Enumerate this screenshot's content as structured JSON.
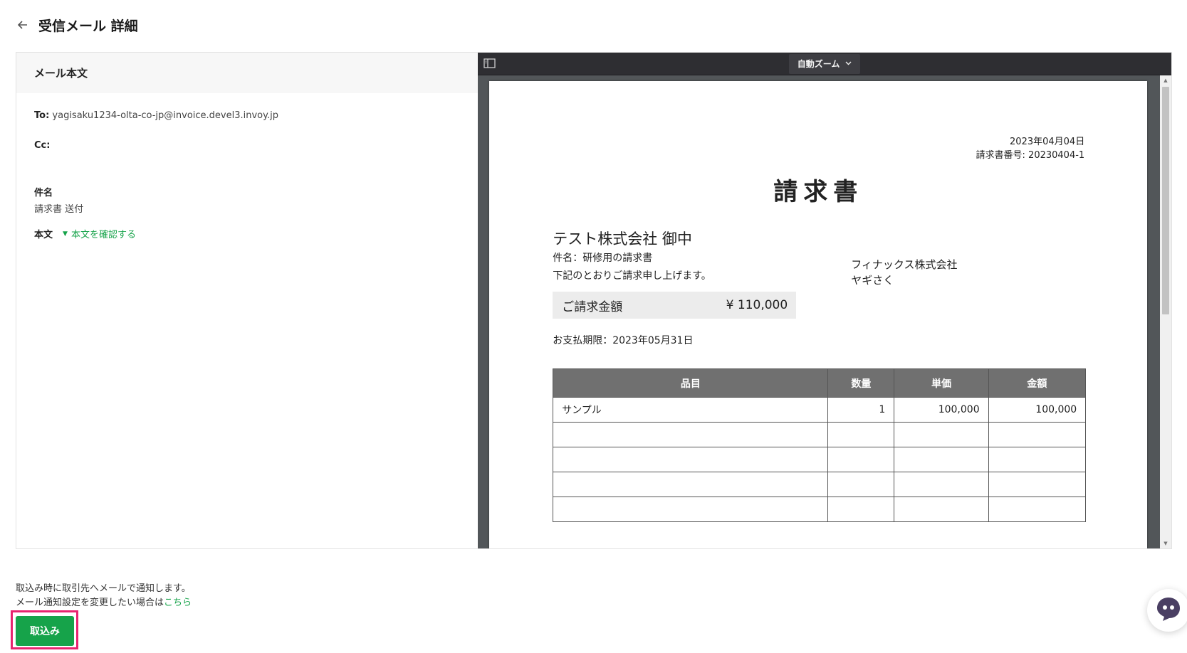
{
  "header": {
    "title": "受信メール 詳細",
    "back_icon": "arrow-left-icon"
  },
  "mail": {
    "section_title": "メール本文",
    "to_label": "To:",
    "to_value": "yagisaku1234-olta-co-jp@invoice.devel3.invoy.jp",
    "cc_label": "Cc:",
    "cc_value": "",
    "subject_label": "件名",
    "subject_value": "請求書 送付",
    "body_label": "本文",
    "body_toggle": "本文を確認する"
  },
  "pdf_viewer": {
    "zoom_label": "自動ズーム",
    "sidebar_icon": "sidebar-toggle-icon",
    "scroll_fraction": 0.0
  },
  "invoice": {
    "date": "2023年04月04日",
    "number": "請求書番号: 20230404-1",
    "title": "請求書",
    "client": "テスト株式会社 御中",
    "subject": "件名：研修用の請求書",
    "note": "下記のとおりご請求申し上げます。",
    "issuer_company": "フィナックス株式会社",
    "issuer_person": "ヤギさく",
    "amount_label": "ご請求金額",
    "amount_value": "¥ 110,000",
    "due": "お支払期限：2023年05月31日",
    "table": {
      "headers": [
        "品目",
        "数量",
        "単価",
        "金額"
      ],
      "rows": [
        [
          "サンプル",
          "1",
          "100,000",
          "100,000"
        ],
        [
          "",
          "",
          "",
          ""
        ],
        [
          "",
          "",
          "",
          ""
        ],
        [
          "",
          "",
          "",
          ""
        ],
        [
          "",
          "",
          "",
          ""
        ]
      ]
    }
  },
  "notice": {
    "line1": "取込み時に取引先へメールで通知します。",
    "line2_prefix": "メール通知設定を変更したい場合は",
    "line2_link": "こちら"
  },
  "actions": {
    "import_label": "取込み"
  },
  "colors": {
    "accent_green": "#16a34a",
    "highlight_pink": "#e8246f",
    "toolbar_dark": "#2e2e32"
  }
}
